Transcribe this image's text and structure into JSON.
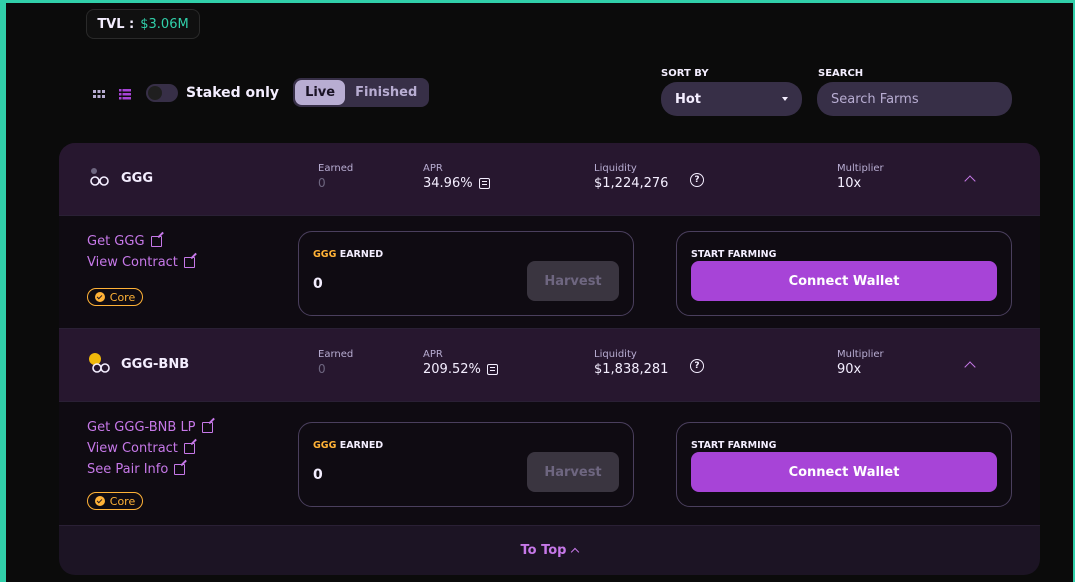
{
  "tvl": {
    "label": "TVL :",
    "value": "$3.06M"
  },
  "toolbar": {
    "staked_only_label": "Staked only",
    "staked_only_on": false,
    "tabs": [
      {
        "label": "Live",
        "active": true
      },
      {
        "label": "Finished",
        "active": false
      }
    ]
  },
  "sort": {
    "label": "SORT BY",
    "value": "Hot"
  },
  "search": {
    "label": "SEARCH",
    "placeholder": "Search Farms"
  },
  "columns": {
    "earned": "Earned",
    "apr": "APR",
    "liquidity": "Liquidity",
    "multiplier": "Multiplier"
  },
  "farms": [
    {
      "name": "GGG",
      "earned": "0",
      "apr": "34.96%",
      "liquidity": "$1,224,276",
      "multiplier": "10x",
      "links": [
        "Get GGG",
        "View Contract"
      ],
      "badge": "Core",
      "earned_title_token": "GGG",
      "earned_title_rest": " EARNED",
      "earned_value": "0",
      "harvest_label": "Harvest",
      "start_farming_label": "START FARMING",
      "connect_label": "Connect Wallet"
    },
    {
      "name": "GGG-BNB",
      "earned": "0",
      "apr": "209.52%",
      "liquidity": "$1,838,281",
      "multiplier": "90x",
      "links": [
        "Get GGG-BNB LP",
        "View Contract",
        "See Pair Info"
      ],
      "badge": "Core",
      "earned_title_token": "GGG",
      "earned_title_rest": " EARNED",
      "earned_value": "0",
      "harvest_label": "Harvest",
      "start_farming_label": "START FARMING",
      "connect_label": "Connect Wallet"
    }
  ],
  "to_top_label": "To Top",
  "colors": {
    "accent": "#a744d7",
    "teal": "#31d0aa",
    "gold": "#ffb237",
    "row_bg": "#27172f"
  }
}
